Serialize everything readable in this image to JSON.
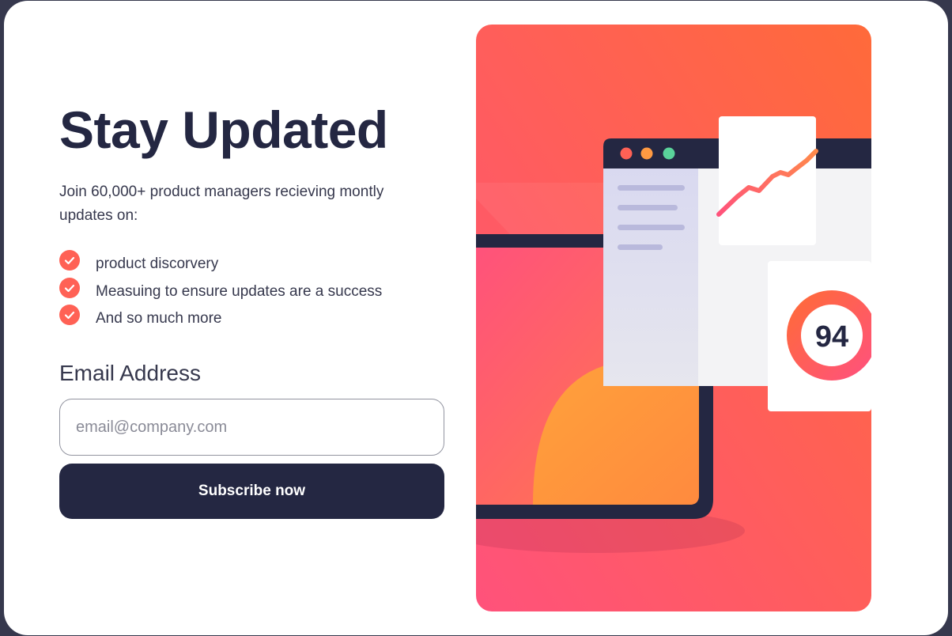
{
  "signup": {
    "title": "Stay Updated",
    "intro": "Join 60,000+ product managers recieving montly updates on:",
    "features": [
      "product discorvery",
      "Measuing to ensure updates are a success",
      "And so much more"
    ],
    "email_label": "Email Address",
    "email_placeholder": "email@company.com",
    "email_value": "",
    "subscribe_label": "Subscribe now"
  },
  "illustration": {
    "score": "94",
    "window_dots": [
      "red-dot-icon",
      "orange-dot-icon",
      "green-dot-icon"
    ]
  },
  "colors": {
    "dark_navy": "#242742",
    "charcoal": "#36384d",
    "tomato": "#ff6155",
    "white": "#ffffff",
    "gradient_pink": "#ff527b",
    "gradient_orange": "#ff6a3a"
  }
}
